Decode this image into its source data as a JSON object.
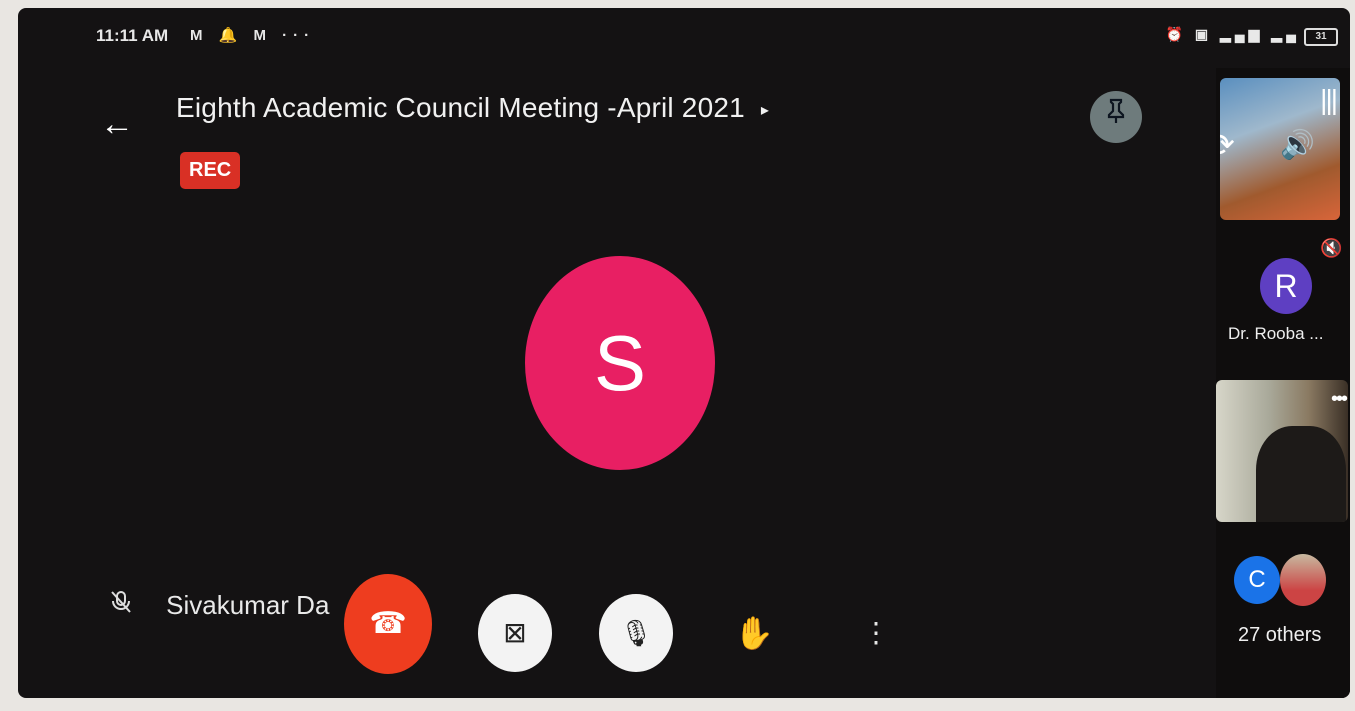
{
  "status_bar": {
    "time": "11:11 AM",
    "left_icons": "M  🔔  M  ···",
    "right_icons": "⏰ ▣ ▂▄▆ ▂▄",
    "battery": "31"
  },
  "meeting": {
    "title": "Eighth Academic Council Meeting -April 2021",
    "title_caret": "▸",
    "rec_badge": "REC"
  },
  "main_speaker": {
    "initial": "S",
    "name": "Sivakumar Da      ran",
    "avatar_color": "#e81f63"
  },
  "controls": {
    "end_call_icon": "☎",
    "camera_icon": "⊠",
    "mic_icon": "🎙",
    "hand_icon": "✋",
    "more_icon": "⋮"
  },
  "participants": {
    "tile1_overlay_switch": "⟳",
    "tile1_overlay_audio": "🔊",
    "tile1_overlay_bars": "|||",
    "participant_r_initial": "R",
    "participant_r_name": "Dr. Rooba ...",
    "participant_r_mute": "🔇",
    "camera_tile_more": "•••",
    "others_initial": "C",
    "others_label": "27 others"
  }
}
